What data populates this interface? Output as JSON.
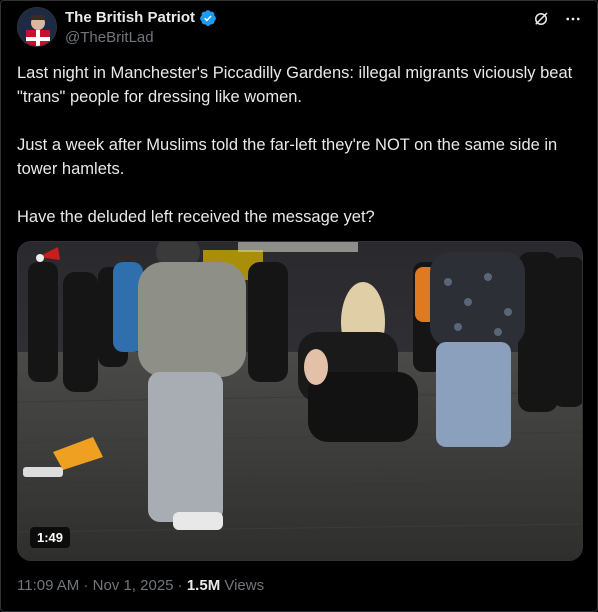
{
  "account": {
    "display_name": "The British Patriot",
    "handle": "@TheBritLad"
  },
  "post": {
    "paragraphs": [
      "Last night in Manchester's Piccadilly Gardens: illegal migrants viciously beat \"trans\" people for dressing like women.",
      "Just a week after Muslims told the far-left they're NOT on the same side in tower hamlets.",
      "Have the deluded left received the message yet?"
    ]
  },
  "media": {
    "duration": "1:49"
  },
  "meta": {
    "time": "11:09 AM",
    "separator": " · ",
    "date": "Nov 1, 2025",
    "separator2": " · ",
    "views_count": "1.5M",
    "views_label": " Views"
  },
  "colors": {
    "background": "#000000",
    "text": "#e7e9ea",
    "muted": "#71767b",
    "verified": "#1d9bf0"
  }
}
